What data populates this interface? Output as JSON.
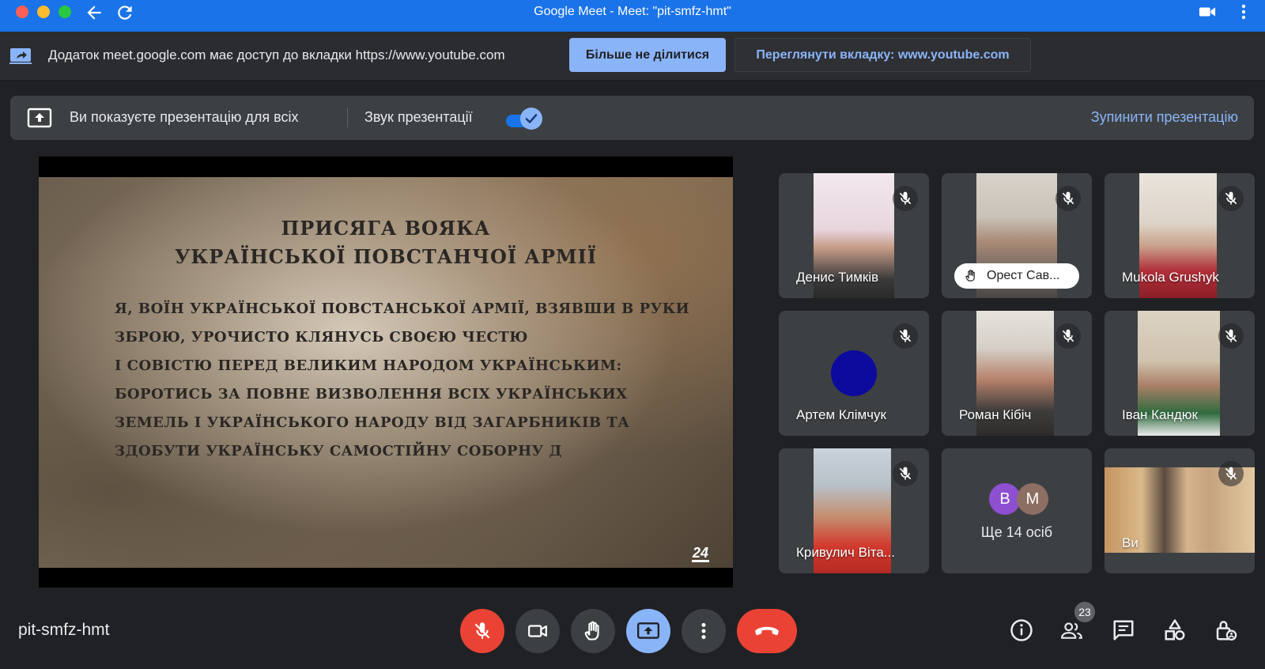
{
  "window": {
    "title": "Google Meet - Meet: \"pit-smfz-hmt\""
  },
  "share_bar": {
    "message": "Додаток meet.google.com має доступ до вкладки https://www.youtube.com",
    "stop_sharing_label": "Більше не ділитися",
    "view_tab_label": "Переглянути вкладку: www.youtube.com"
  },
  "presentation_bar": {
    "status": "Ви показуєте презентацію для всіх",
    "audio_label": "Звук презентації",
    "audio_enabled": true,
    "stop_label": "Зупинити презентацію"
  },
  "shared_video": {
    "title_line1": "ПРИСЯГА ВОЯКА",
    "title_line2": "УКРАЇНСЬКОЇ ПОВСТАНЧОЇ АРМІЇ",
    "lines": [
      "Я, ВОЇН УКРАЇНСЬКОЇ ПОВСТАНСЬКОЇ АРМІЇ, ВЗЯВШИ В РУКИ",
      "ЗБРОЮ, УРОЧИСТО КЛЯНУСЬ СВОЄЮ ЧЕСТЮ",
      "І СОВІСТЮ ПЕРЕД ВЕЛИКИМ НАРОДОМ УКРАЇНСЬКИМ:",
      "БОРОТИСЬ ЗА ПОВНЕ ВИЗВОЛЕННЯ ВСІХ УКРАЇНСЬКИХ",
      "ЗЕМЕЛЬ І УКРАЇНСЬКОГО НАРОДУ ВІД ЗАГАРБНИКІВ ТА",
      "ЗДОБУТИ УКРАЇНСЬКУ САМОСТІЙНУ СОБОРНУ Д"
    ],
    "channel_logo": "24"
  },
  "participants": [
    {
      "name": "Денис Тимків",
      "muted": true
    },
    {
      "name": "Орест Сав...",
      "muted": true,
      "hand_raised": true
    },
    {
      "name": "Mukola Grushyk",
      "muted": true
    },
    {
      "name": "Артем Клімчук",
      "muted": true
    },
    {
      "name": "Роман Кібіч",
      "muted": true
    },
    {
      "name": "Іван Кандюк",
      "muted": true
    },
    {
      "name": "Кривулич Віта...",
      "muted": true
    },
    {
      "name": "Ви",
      "muted": true
    }
  ],
  "others_tile": {
    "avatars": [
      {
        "letter": "В",
        "color": "#8e4fd1"
      },
      {
        "letter": "М",
        "color": "#8d6e63"
      }
    ],
    "label": "Ще 14 осіб"
  },
  "bottom_bar": {
    "meeting_code": "pit-smfz-hmt",
    "people_count": "23"
  }
}
